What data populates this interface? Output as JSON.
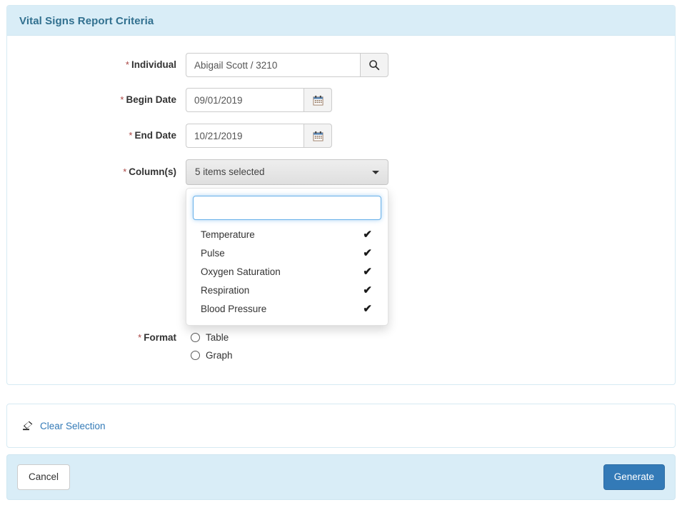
{
  "panel": {
    "title": "Vital Signs Report Criteria"
  },
  "fields": {
    "individual": {
      "label": "Individual",
      "required_marker": "*",
      "value": "Abigail Scott / 3210",
      "placeholder": "",
      "search_icon": "search-icon"
    },
    "begin_date": {
      "label": "Begin Date",
      "required_marker": "*",
      "value": "09/01/2019",
      "placeholder": "",
      "calendar_icon": "calendar-icon"
    },
    "end_date": {
      "label": "End Date",
      "required_marker": "*",
      "value": "10/21/2019",
      "placeholder": "",
      "calendar_icon": "calendar-icon"
    },
    "columns": {
      "label": "Column(s)",
      "required_marker": "*",
      "button_text": "5 items selected",
      "caret_icon": "chevron-down-icon",
      "search_value": "",
      "search_placeholder": "",
      "options": [
        {
          "label": "Temperature",
          "checked": true,
          "check_glyph": "✔"
        },
        {
          "label": "Pulse",
          "checked": true,
          "check_glyph": "✔"
        },
        {
          "label": "Oxygen Saturation",
          "checked": true,
          "check_glyph": "✔"
        },
        {
          "label": "Respiration",
          "checked": true,
          "check_glyph": "✔"
        },
        {
          "label": "Blood Pressure",
          "checked": true,
          "check_glyph": "✔"
        }
      ]
    },
    "format": {
      "label": "Format",
      "required_marker": "*",
      "options": [
        {
          "label": "Table",
          "selected": false
        },
        {
          "label": "Graph",
          "selected": false
        }
      ]
    }
  },
  "clear_selection": {
    "label": "Clear Selection",
    "icon": "eraser-icon"
  },
  "footer": {
    "cancel_label": "Cancel",
    "generate_label": "Generate"
  },
  "colors": {
    "header_bg": "#d9edf7",
    "header_text": "#31708f",
    "primary_button": "#337ab7",
    "link": "#337ab7",
    "required_star": "#a94442",
    "focus_border": "#66afe9"
  }
}
